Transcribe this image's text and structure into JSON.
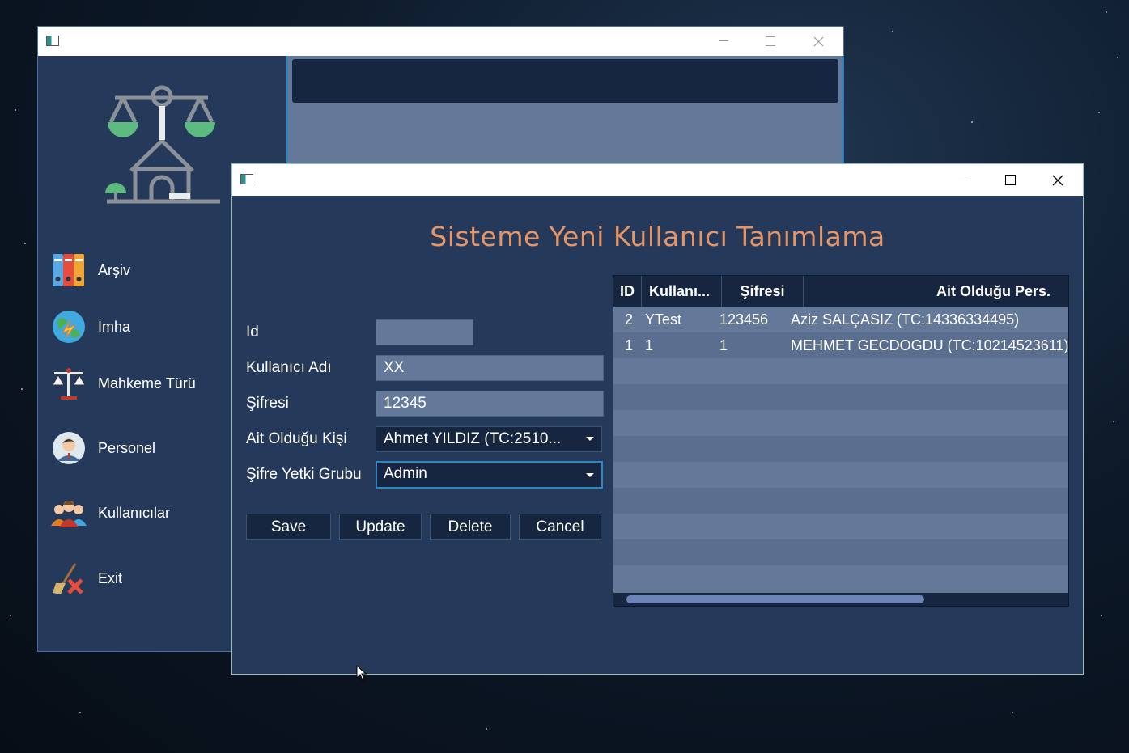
{
  "main_window": {
    "sidebar": {
      "items": [
        {
          "label": "Arşiv",
          "icon": "binders-icon"
        },
        {
          "label": "İmha",
          "icon": "globe-destroy-icon"
        },
        {
          "label": "Mahkeme Türü",
          "icon": "justice-scale-icon"
        },
        {
          "label": "Personel",
          "icon": "person-avatar-icon"
        },
        {
          "label": "Kullanıcılar",
          "icon": "users-group-icon"
        },
        {
          "label": "Exit",
          "icon": "exit-broom-icon"
        }
      ]
    }
  },
  "dialog": {
    "heading": "Sisteme Yeni Kullanıcı Tanımlama",
    "form": {
      "id_label": "Id",
      "id_value": "",
      "username_label": "Kullanıcı Adı",
      "username_value": "XX",
      "password_label": "Şifresi",
      "password_value": "12345",
      "person_label": "Ait Olduğu Kişi",
      "person_value": "Ahmet YILDIZ (TC:2510...",
      "group_label": "Şifre Yetki Grubu",
      "group_value": "Admin"
    },
    "buttons": {
      "save": "Save",
      "update": "Update",
      "delete": "Delete",
      "cancel": "Cancel"
    },
    "table": {
      "columns": [
        "ID",
        "Kullanı...",
        "Şifresi",
        "Ait Olduğu Pers."
      ],
      "rows": [
        {
          "id": "2",
          "user": "YTest",
          "password": "123456",
          "person": "Aziz SALÇASIZ (TC:14336334495)"
        },
        {
          "id": "1",
          "user": "1",
          "password": "1",
          "person": "MEHMET GECDOGDU (TC:10214523611)"
        }
      ]
    }
  },
  "colors": {
    "panel": "#25395a",
    "field": "#64799a",
    "dark": "#172640",
    "accent_title": "#e89565",
    "focus": "#2d86c4"
  }
}
